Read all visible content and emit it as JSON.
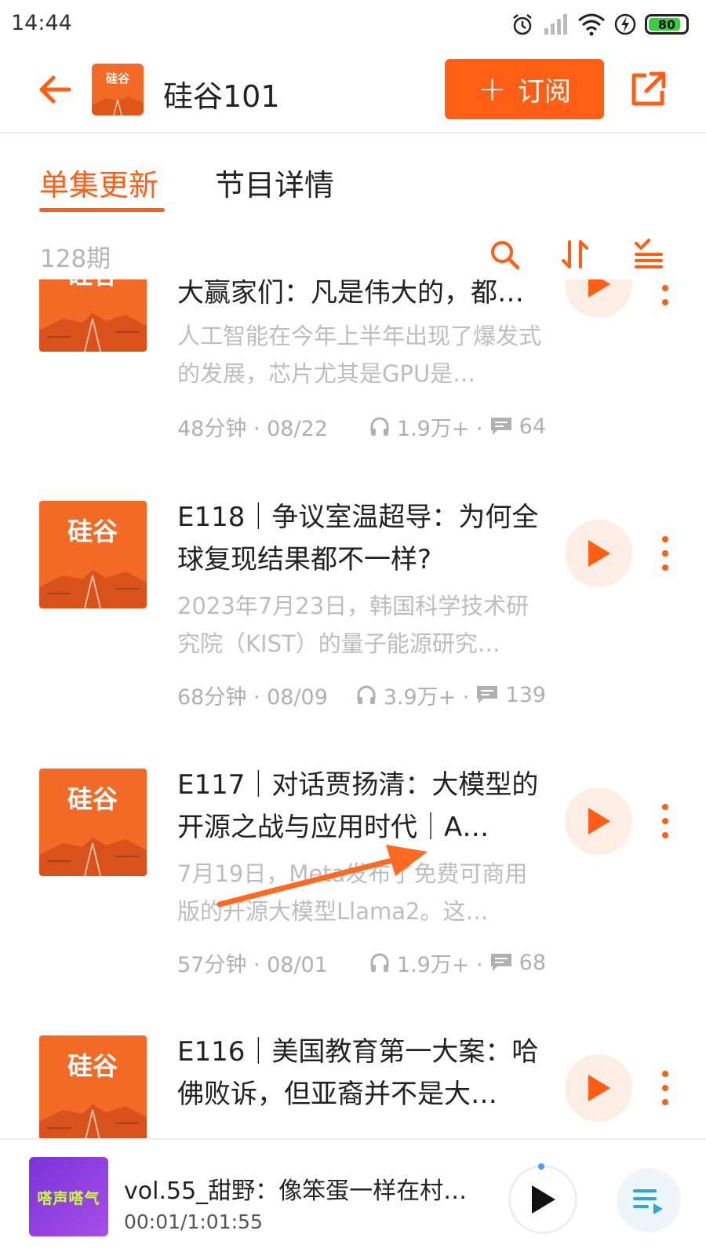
{
  "status_bar": {
    "time": "14:44",
    "battery": "80",
    "icons": [
      "alarm-icon",
      "signal-icon",
      "wifi-icon",
      "charging-icon",
      "battery-icon"
    ]
  },
  "header": {
    "title": "硅谷101",
    "subscribe_label": "订阅",
    "cover_text": "硅谷",
    "colors": {
      "accent": "#ff5e14"
    }
  },
  "tabs": [
    {
      "label": "单集更新",
      "active": true
    },
    {
      "label": "节目详情",
      "active": false
    }
  ],
  "list_toolbar": {
    "count": "128期",
    "icons": [
      "search-icon",
      "sort-icon",
      "filter-list-icon"
    ]
  },
  "episodes": [
    {
      "title": "大赢家们：凡是伟大的，都…",
      "desc": "人工智能在今年上半年出现了爆发式的发展，芯片尤其是GPU是…",
      "duration_date": "48分钟 · 08/22",
      "plays": "1.9万+ ·",
      "comments": "64"
    },
    {
      "title": "E118｜争议室温超导：为何全球复现结果都不一样?",
      "desc": "2023年7月23日，韩国科学技术研究院（KIST）的量子能源研究…",
      "duration_date": "68分钟 · 08/09",
      "plays": "3.9万+ ·",
      "comments": "139"
    },
    {
      "title": "E117｜对话贾扬清：大模型的开源之战与应用时代｜A…",
      "desc": "7月19日，Meta发布了免费可商用版的开源大模型Llama2。这…",
      "duration_date": "57分钟 · 08/01",
      "plays": "1.9万+ ·",
      "comments": "68"
    },
    {
      "title": "E116｜美国教育第一大案：哈佛败诉，但亚裔并不是大…",
      "desc": "",
      "duration_date": "",
      "plays": "",
      "comments": ""
    }
  ],
  "mini_player": {
    "title": "vol.55_甜野：像笨蛋一样在村…",
    "time": "00:01/1:01:55",
    "cover_text": "嗒声嗒气"
  }
}
